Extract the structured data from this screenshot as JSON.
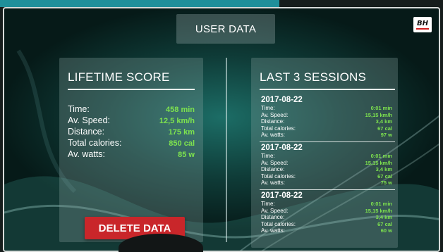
{
  "header": {
    "title": "USER DATA"
  },
  "brand": {
    "logo_text": "BH",
    "accent": "#d02020"
  },
  "colors": {
    "value_green": "#7ee34e",
    "delete_red": "#c9262a",
    "top_band": "#1f8f9a"
  },
  "lifetime": {
    "title": "LIFETIME SCORE",
    "rows": [
      {
        "label": "Time:",
        "value": "458 min"
      },
      {
        "label": "Av. Speed:",
        "value": "12,5 km/h"
      },
      {
        "label": "Distance:",
        "value": "175 km"
      },
      {
        "label": "Total calories:",
        "value": "850 cal"
      },
      {
        "label": "Av. watts:",
        "value": "85 w"
      }
    ],
    "delete_label": "DELETE DATA"
  },
  "sessions": {
    "title": "LAST 3 SESSIONS",
    "items": [
      {
        "date": "2017-08-22",
        "rows": [
          {
            "label": "Time:",
            "value": "0:01 min"
          },
          {
            "label": "Av. Speed:",
            "value": "15,15 km/h"
          },
          {
            "label": "Distance:",
            "value": "3,4 km"
          },
          {
            "label": "Total calories:",
            "value": "67 cal"
          },
          {
            "label": "Av. watts:",
            "value": "97 w"
          }
        ]
      },
      {
        "date": "2017-08-22",
        "rows": [
          {
            "label": "Time:",
            "value": "0:01 min"
          },
          {
            "label": "Av. Speed:",
            "value": "15,15 km/h"
          },
          {
            "label": "Distance:",
            "value": "3,4 km"
          },
          {
            "label": "Total calories:",
            "value": "67 cal"
          },
          {
            "label": "Av. watts:",
            "value": "75 w"
          }
        ]
      },
      {
        "date": "2017-08-22",
        "rows": [
          {
            "label": "Time:",
            "value": "0:01 min"
          },
          {
            "label": "Av. Speed:",
            "value": "15,15 km/h"
          },
          {
            "label": "Distance:",
            "value": "3,4 km"
          },
          {
            "label": "Total calories:",
            "value": "67 cal"
          },
          {
            "label": "Av. watts:",
            "value": "60 w"
          }
        ]
      }
    ]
  }
}
